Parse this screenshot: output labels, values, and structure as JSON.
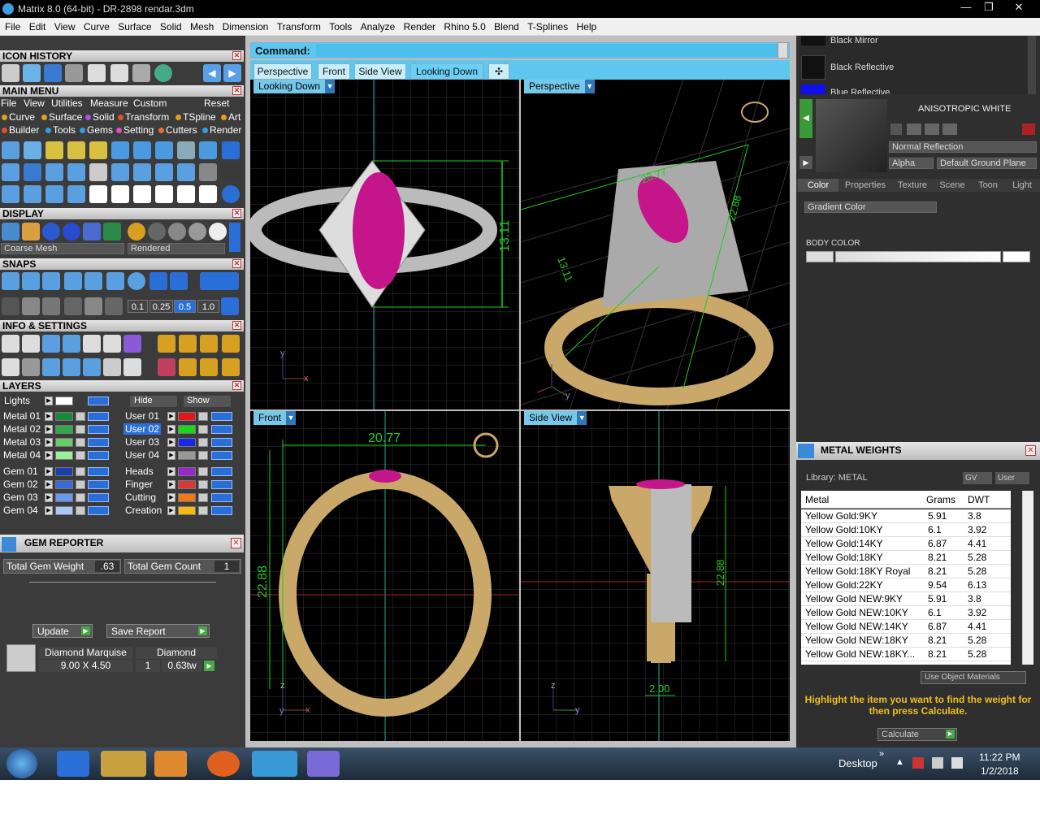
{
  "window": {
    "title": "Matrix 8.0 (64-bit) - DR-2898 rendar.3dm",
    "minimize": "—",
    "restore": "❐",
    "close": "✕"
  },
  "menubar": [
    "File",
    "Edit",
    "View",
    "Curve",
    "Surface",
    "Solid",
    "Mesh",
    "Dimension",
    "Transform",
    "Tools",
    "Analyze",
    "Render",
    "Rhino 5.0",
    "Blend",
    "T-Splines",
    "Help"
  ],
  "left": {
    "icon_history": "ICON HISTORY",
    "main_menu": "MAIN MENU",
    "main_menu_items": [
      "File",
      "View",
      "Utilities",
      "Measure",
      "Custom",
      "Reset"
    ],
    "main_row1": [
      {
        "label": "Curve",
        "color": "#e0a020"
      },
      {
        "label": "Surface",
        "color": "#e0a020"
      },
      {
        "label": "Solid",
        "color": "#b050e0"
      },
      {
        "label": "Transform",
        "color": "#e05030"
      },
      {
        "label": "TSpline",
        "color": "#e0a020"
      },
      {
        "label": "Art",
        "color": "#e0a020"
      }
    ],
    "main_row2": [
      {
        "label": "Builder",
        "color": "#e05030"
      },
      {
        "label": "Tools",
        "color": "#30a0e0"
      },
      {
        "label": "Gems",
        "color": "#30a0e0"
      },
      {
        "label": "Setting",
        "color": "#e050c0"
      },
      {
        "label": "Cutters",
        "color": "#e07030"
      },
      {
        "label": "Render",
        "color": "#30a0e0"
      }
    ],
    "display": "DISPLAY",
    "display_mesh": "Coarse Mesh",
    "display_render": "Rendered",
    "snaps": "SNAPS",
    "snap_values": [
      "0.1",
      "0.25",
      "0.5",
      "1.0"
    ],
    "info": "INFO & SETTINGS",
    "layers": "LAYERS",
    "lights": "Lights",
    "hide": "Hide",
    "show": "Show",
    "layers_left": [
      {
        "name": "Metal 01",
        "color": "#1a8a3a"
      },
      {
        "name": "Metal 02",
        "color": "#2fa84f"
      },
      {
        "name": "Metal 03",
        "color": "#66cc66"
      },
      {
        "name": "Metal 04",
        "color": "#99ee99"
      },
      {
        "name": "Gem 01",
        "color": "#1a3fa8"
      },
      {
        "name": "Gem 02",
        "color": "#3a6ad8"
      },
      {
        "name": "Gem 03",
        "color": "#6a9af0"
      },
      {
        "name": "Gem 04",
        "color": "#a8c8f8"
      }
    ],
    "layers_right": [
      {
        "name": "User 01",
        "color": "#e01818"
      },
      {
        "name": "User 02",
        "color": "#18d818"
      },
      {
        "name": "User 03",
        "color": "#1828e8"
      },
      {
        "name": "User 04",
        "color": "#999999"
      },
      {
        "name": "Heads",
        "color": "#9a28c8"
      },
      {
        "name": "Finger",
        "color": "#d83838"
      },
      {
        "name": "Cutting",
        "color": "#f07818"
      },
      {
        "name": "Creation",
        "color": "#f8b818"
      }
    ],
    "gem_reporter": "GEM REPORTER",
    "total_gem_weight_label": "Total Gem Weight",
    "total_gem_weight": ".63",
    "total_gem_count_label": "Total Gem Count",
    "total_gem_count": "1",
    "update": "Update",
    "save_report": "Save Report",
    "gem_name": "Diamond Marquise",
    "gem_type": "Diamond",
    "gem_size": "9.00 X 4.50",
    "gem_qty": "1",
    "gem_tw": "0.63tw"
  },
  "viewport": {
    "command_label": "Command:",
    "tabs": [
      "Perspective",
      "Front",
      "Side View",
      "Looking Down"
    ],
    "add_tab": "✣",
    "views": {
      "top": "Looking Down",
      "persp": "Perspective",
      "front": "Front",
      "side": "Side View"
    },
    "dims": {
      "top_h": "13.11",
      "persp_a": "20.77",
      "persp_b": "13.11",
      "persp_c": "22.88",
      "front_w": "20.77",
      "front_h": "22.88",
      "side_h": "22.88",
      "side_w": "2.00"
    },
    "axes": {
      "x": "x",
      "y": "y",
      "z": "z"
    }
  },
  "right": {
    "materials": [
      "Black Mirror",
      "Black Reflective",
      "Blue Reflective"
    ],
    "material_title": "ANISOTROPIC WHITE",
    "reflection": "Normal Reflection",
    "alpha": "Alpha",
    "ground": "Default Ground Plane",
    "tabs": [
      "Color",
      "Properties",
      "Texture",
      "Scene",
      "Toon",
      "Light"
    ],
    "gradient": "Gradient Color",
    "body_color": "BODY COLOR",
    "metal_weights": "METAL WEIGHTS",
    "library": "Library: METAL",
    "gv": "GV",
    "user": "User",
    "cols": [
      "Metal",
      "Grams",
      "DWT"
    ],
    "rows": [
      [
        "Yellow Gold:9KY",
        "5.91",
        "3.8"
      ],
      [
        "Yellow Gold:10KY",
        "6.1",
        "3.92"
      ],
      [
        "Yellow Gold:14KY",
        "6.87",
        "4.41"
      ],
      [
        "Yellow Gold:18KY",
        "8.21",
        "5.28"
      ],
      [
        "Yellow Gold:18KY Royal",
        "8.21",
        "5.28"
      ],
      [
        "Yellow Gold:22KY",
        "9.54",
        "6.13"
      ],
      [
        "Yellow Gold NEW:9KY",
        "5.91",
        "3.8"
      ],
      [
        "Yellow Gold NEW:10KY",
        "6.1",
        "3.92"
      ],
      [
        "Yellow Gold NEW:14KY",
        "6.87",
        "4.41"
      ],
      [
        "Yellow Gold NEW:18KY",
        "8.21",
        "5.28"
      ],
      [
        "Yellow Gold NEW:18KY...",
        "8.21",
        "5.28"
      ]
    ],
    "use_object": "Use Object Materials",
    "hint": "Highlight the item you want to find the weight for then press Calculate.",
    "calculate": "Calculate"
  },
  "taskbar": {
    "desktop": "Desktop",
    "time": "11:22 PM",
    "date": "1/2/2018"
  }
}
